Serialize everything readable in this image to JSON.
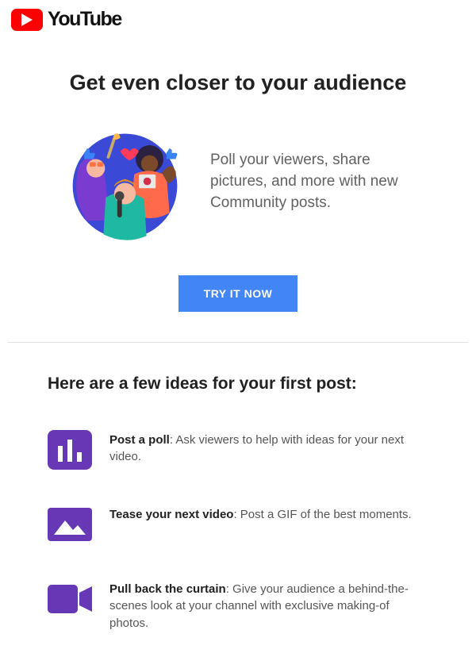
{
  "brand": {
    "name": "YouTube"
  },
  "hero": {
    "title": "Get even closer to your audience",
    "description": "Poll your viewers, share pictures, and more with new Community posts.",
    "cta_label": "TRY IT NOW"
  },
  "ideas": {
    "title": "Here are a few ideas for your first post:",
    "items": [
      {
        "bold": "Post a poll",
        "rest": ": Ask viewers to help with ideas for your next video."
      },
      {
        "bold": "Tease your next video",
        "rest": ": Post a GIF of the best moments."
      },
      {
        "bold": "Pull back the curtain",
        "rest": ": Give your audience a behind-the-scenes look at your channel with exclusive making-of photos."
      }
    ]
  },
  "colors": {
    "accent_purple": "#6638b6",
    "cta_blue": "#4285f4",
    "youtube_red": "#ff0000"
  }
}
